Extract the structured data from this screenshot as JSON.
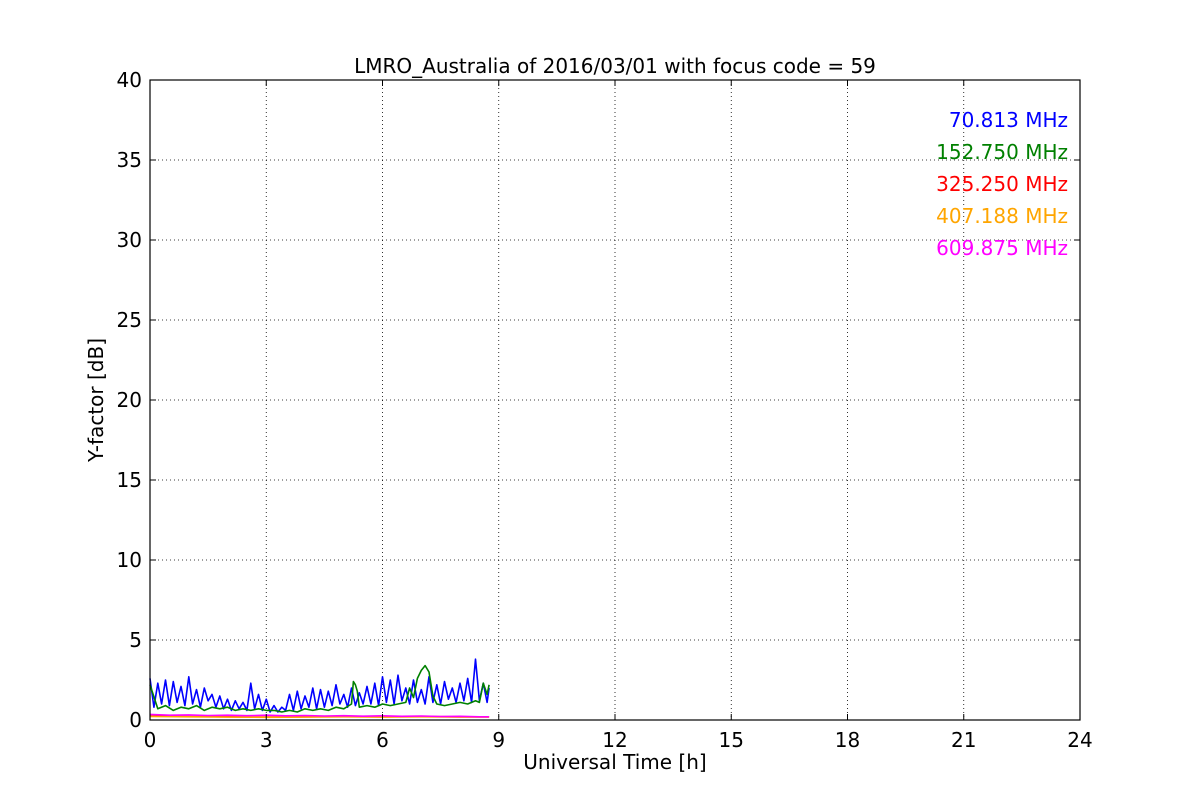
{
  "chart_data": {
    "type": "line",
    "title": "LMRO_Australia of 2016/03/01 with focus code = 59",
    "xlabel": "Universal Time [h]",
    "ylabel": "Y-factor [dB]",
    "xlim": [
      0,
      24
    ],
    "ylim": [
      0,
      40
    ],
    "xticks": [
      0,
      3,
      6,
      9,
      12,
      15,
      18,
      21,
      24
    ],
    "yticks": [
      0,
      5,
      10,
      15,
      20,
      25,
      30,
      35,
      40
    ],
    "grid": true,
    "legend_position": "top-right",
    "series": [
      {
        "name": "70.813 MHz",
        "color": "#0000ff",
        "x": [
          0.0,
          0.1,
          0.2,
          0.3,
          0.4,
          0.5,
          0.6,
          0.7,
          0.8,
          0.9,
          1.0,
          1.1,
          1.2,
          1.3,
          1.4,
          1.5,
          1.6,
          1.7,
          1.8,
          1.9,
          2.0,
          2.1,
          2.2,
          2.3,
          2.4,
          2.5,
          2.6,
          2.7,
          2.8,
          2.9,
          3.0,
          3.1,
          3.2,
          3.3,
          3.4,
          3.5,
          3.6,
          3.7,
          3.8,
          3.9,
          4.0,
          4.1,
          4.2,
          4.3,
          4.4,
          4.5,
          4.6,
          4.7,
          4.8,
          4.9,
          5.0,
          5.1,
          5.2,
          5.3,
          5.4,
          5.5,
          5.6,
          5.7,
          5.8,
          5.9,
          6.0,
          6.1,
          6.2,
          6.3,
          6.4,
          6.5,
          6.6,
          6.7,
          6.8,
          6.9,
          7.0,
          7.1,
          7.2,
          7.3,
          7.4,
          7.5,
          7.6,
          7.7,
          7.8,
          7.9,
          8.0,
          8.1,
          8.2,
          8.3,
          8.4,
          8.5,
          8.6,
          8.7,
          8.75
        ],
        "values": [
          2.6,
          0.8,
          2.3,
          1.0,
          2.5,
          0.9,
          2.4,
          1.1,
          2.1,
          0.9,
          2.7,
          1.0,
          1.9,
          0.8,
          2.0,
          1.2,
          1.6,
          0.8,
          1.5,
          0.7,
          1.3,
          0.6,
          1.2,
          0.7,
          1.1,
          0.6,
          2.3,
          0.7,
          1.6,
          0.6,
          1.3,
          0.5,
          0.9,
          0.5,
          0.8,
          0.6,
          1.6,
          0.6,
          1.8,
          0.7,
          1.5,
          0.8,
          2.0,
          0.7,
          1.9,
          0.8,
          1.8,
          0.9,
          2.2,
          1.0,
          1.6,
          0.8,
          2.0,
          0.9,
          1.7,
          1.0,
          2.1,
          1.0,
          2.3,
          0.9,
          2.7,
          1.1,
          2.5,
          1.0,
          2.8,
          1.2,
          2.0,
          1.0,
          2.5,
          1.1,
          1.9,
          1.0,
          2.7,
          1.1,
          2.2,
          1.0,
          2.4,
          1.3,
          2.0,
          1.1,
          2.3,
          1.2,
          2.6,
          1.1,
          3.8,
          1.2,
          2.3,
          1.1,
          2.0
        ]
      },
      {
        "name": "152.750 MHz",
        "color": "#008000",
        "x": [
          0.0,
          0.2,
          0.4,
          0.6,
          0.8,
          1.0,
          1.2,
          1.4,
          1.6,
          1.8,
          2.0,
          2.2,
          2.4,
          2.6,
          2.8,
          3.0,
          3.2,
          3.4,
          3.6,
          3.8,
          4.0,
          4.2,
          4.4,
          4.6,
          4.8,
          5.0,
          5.2,
          5.25,
          5.3,
          5.35,
          5.4,
          5.6,
          5.8,
          6.0,
          6.2,
          6.4,
          6.6,
          6.7,
          6.8,
          6.9,
          7.0,
          7.1,
          7.2,
          7.3,
          7.4,
          7.6,
          7.8,
          8.0,
          8.2,
          8.4,
          8.5,
          8.6,
          8.7,
          8.75
        ],
        "values": [
          2.2,
          0.7,
          0.9,
          0.6,
          0.8,
          0.7,
          0.9,
          0.6,
          0.8,
          0.7,
          0.8,
          0.6,
          0.7,
          0.6,
          0.7,
          0.6,
          0.6,
          0.5,
          0.6,
          0.5,
          0.7,
          0.6,
          0.7,
          0.6,
          0.8,
          0.7,
          1.0,
          2.4,
          2.2,
          1.8,
          0.8,
          0.9,
          0.8,
          1.0,
          0.9,
          1.0,
          1.1,
          2.0,
          1.4,
          2.6,
          3.1,
          3.4,
          3.0,
          1.5,
          1.0,
          0.9,
          1.0,
          1.1,
          1.0,
          1.2,
          1.1,
          2.3,
          1.6,
          2.2
        ]
      },
      {
        "name": "325.250 MHz",
        "color": "#ff0000",
        "x": [
          0.0,
          1.0,
          2.0,
          3.0,
          4.0,
          5.0,
          6.0,
          7.0,
          8.0,
          8.75
        ],
        "values": [
          0.25,
          0.22,
          0.2,
          0.18,
          0.2,
          0.22,
          0.2,
          0.22,
          0.2,
          0.2
        ]
      },
      {
        "name": "407.188 MHz",
        "color": "#ffa500",
        "x": [
          0.0,
          1.0,
          2.0,
          3.0,
          4.0,
          5.0,
          6.0,
          7.0,
          8.0,
          8.75
        ],
        "values": [
          0.22,
          0.2,
          0.18,
          0.17,
          0.18,
          0.2,
          0.18,
          0.2,
          0.18,
          0.18
        ]
      },
      {
        "name": "609.875 MHz",
        "color": "#ff00ff",
        "x": [
          0.0,
          0.5,
          1.0,
          1.5,
          2.0,
          2.5,
          3.0,
          3.5,
          4.0,
          4.5,
          5.0,
          5.5,
          6.0,
          6.5,
          7.0,
          7.5,
          8.0,
          8.5,
          8.75
        ],
        "values": [
          0.35,
          0.3,
          0.32,
          0.28,
          0.3,
          0.27,
          0.3,
          0.26,
          0.28,
          0.25,
          0.27,
          0.24,
          0.26,
          0.23,
          0.25,
          0.22,
          0.23,
          0.2,
          0.2
        ]
      }
    ]
  }
}
